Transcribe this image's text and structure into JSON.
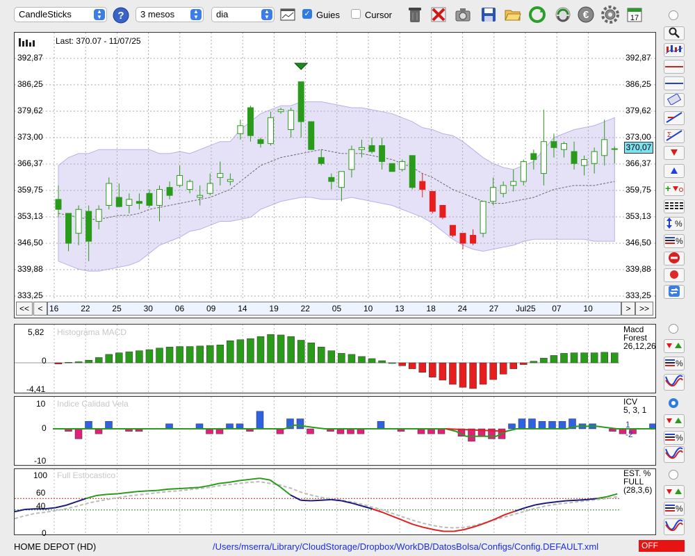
{
  "toolbar": {
    "chart_type": "CandleSticks",
    "period": "3 mesos",
    "interval": "dia",
    "guides_label": "Guies",
    "guides_checked": true,
    "cursor_label": "Cursor",
    "cursor_checked": false,
    "calendar_day": "17",
    "icons": [
      "help-icon",
      "chart-window-icon",
      "trash-icon",
      "delete-icon",
      "camera-icon",
      "save-icon",
      "open-folder-icon",
      "refresh-icon",
      "sync-icon",
      "currency-euro-icon",
      "settings-gear-icon",
      "calendar-icon"
    ]
  },
  "chart": {
    "last_label": "Last: 370.07 - 11/07/25",
    "current_price_tag": "370,07",
    "y_ticks": [
      "392,87",
      "386,25",
      "379,62",
      "373,00",
      "366,37",
      "359,75",
      "353,13",
      "346,50",
      "339,88",
      "333,25"
    ],
    "y_tick_values": [
      392.87,
      386.25,
      379.62,
      373.0,
      366.37,
      359.75,
      353.13,
      346.5,
      339.88,
      333.25
    ],
    "x_labels": [
      "16",
      "22",
      "25",
      "30",
      "06",
      "09",
      "14",
      "19",
      "22",
      "05",
      "10",
      "13",
      "18",
      "24",
      "27",
      "Jul25",
      "07",
      "10"
    ],
    "nav": {
      "first": "<<",
      "prev": "<",
      "next": ">",
      "last": ">>"
    },
    "colors": {
      "up": "#2a9a1a",
      "down": "#e81e1e",
      "band": "#dcd8f4",
      "price_tag": "#7fe0f0"
    }
  },
  "chart_data": [
    {
      "type": "candlestick",
      "title": "Last: 370.07 - 11/07/25",
      "ylim": [
        333.25,
        392.87
      ],
      "candles": [
        {
          "o": 357.5,
          "h": 361,
          "l": 353,
          "c": 355
        },
        {
          "o": 354,
          "h": 354,
          "l": 344.5,
          "c": 346.5
        },
        {
          "o": 349,
          "h": 356,
          "l": 346,
          "c": 355
        },
        {
          "o": 354.5,
          "h": 356,
          "l": 342,
          "c": 347
        },
        {
          "o": 352,
          "h": 356,
          "l": 350,
          "c": 355
        },
        {
          "o": 356,
          "h": 363,
          "l": 355,
          "c": 361.5
        },
        {
          "o": 358,
          "h": 361.5,
          "l": 355.5,
          "c": 355.7
        },
        {
          "o": 356,
          "h": 359,
          "l": 354,
          "c": 357.5
        },
        {
          "o": 357,
          "h": 359,
          "l": 355,
          "c": 356.5
        },
        {
          "o": 359,
          "h": 360,
          "l": 355.5,
          "c": 356
        },
        {
          "o": 356,
          "h": 361,
          "l": 352,
          "c": 360
        },
        {
          "o": 360.5,
          "h": 362,
          "l": 357.5,
          "c": 358.5
        },
        {
          "o": 361,
          "h": 366,
          "l": 360.5,
          "c": 363.5
        },
        {
          "o": 360,
          "h": 362.5,
          "l": 359,
          "c": 362
        },
        {
          "o": 358,
          "h": 361,
          "l": 356,
          "c": 358.5
        },
        {
          "o": 359,
          "h": 364,
          "l": 358.5,
          "c": 361.5
        },
        {
          "o": 363,
          "h": 367,
          "l": 361,
          "c": 364
        },
        {
          "o": 362,
          "h": 364,
          "l": 361,
          "c": 362.5
        },
        {
          "o": 374,
          "h": 377.5,
          "l": 372.5,
          "c": 376
        },
        {
          "o": 380.5,
          "h": 381,
          "l": 372,
          "c": 373.5
        },
        {
          "o": 372.5,
          "h": 373,
          "l": 370.5,
          "c": 371.5
        },
        {
          "o": 371.5,
          "h": 379.5,
          "l": 371,
          "c": 378
        },
        {
          "o": 379.5,
          "h": 380.5,
          "l": 379,
          "c": 380
        },
        {
          "o": 375,
          "h": 380.5,
          "l": 373,
          "c": 379.8
        },
        {
          "o": 387,
          "h": 387,
          "l": 373,
          "c": 377
        },
        {
          "o": 377,
          "h": 377,
          "l": 370,
          "c": 370
        },
        {
          "o": 368,
          "h": 370,
          "l": 366,
          "c": 366.5
        },
        {
          "o": 363,
          "h": 364,
          "l": 360,
          "c": 362
        },
        {
          "o": 360.5,
          "h": 364.5,
          "l": 357,
          "c": 364.5
        },
        {
          "o": 365,
          "h": 371,
          "l": 363,
          "c": 370
        },
        {
          "o": 370,
          "h": 372.5,
          "l": 368,
          "c": 370.5
        },
        {
          "o": 371,
          "h": 373,
          "l": 369,
          "c": 369.5
        },
        {
          "o": 371,
          "h": 373,
          "l": 365,
          "c": 367
        },
        {
          "o": 366.5,
          "h": 366.5,
          "l": 364.5,
          "c": 364.5
        },
        {
          "o": 365,
          "h": 367.5,
          "l": 364.5,
          "c": 367
        },
        {
          "o": 368.5,
          "h": 368.5,
          "l": 360,
          "c": 360.5
        },
        {
          "o": 360,
          "h": 364,
          "l": 358,
          "c": 362
        },
        {
          "o": 359.5,
          "h": 359.5,
          "l": 354,
          "c": 354.5
        },
        {
          "o": 356,
          "h": 356,
          "l": 352.5,
          "c": 353
        },
        {
          "o": 351,
          "h": 351,
          "l": 348,
          "c": 348.5
        },
        {
          "o": 349,
          "h": 349,
          "l": 345,
          "c": 346.5
        },
        {
          "o": 346.5,
          "h": 350,
          "l": 346,
          "c": 348.5
        },
        {
          "o": 349,
          "h": 357,
          "l": 348,
          "c": 357
        },
        {
          "o": 357,
          "h": 363,
          "l": 356,
          "c": 360.5
        },
        {
          "o": 359,
          "h": 362,
          "l": 358,
          "c": 361
        },
        {
          "o": 361,
          "h": 365,
          "l": 359.5,
          "c": 362
        },
        {
          "o": 362,
          "h": 367.5,
          "l": 361,
          "c": 367
        },
        {
          "o": 369,
          "h": 370,
          "l": 365,
          "c": 367.5
        },
        {
          "o": 364,
          "h": 380,
          "l": 361,
          "c": 372
        },
        {
          "o": 372,
          "h": 374,
          "l": 368,
          "c": 370.5
        },
        {
          "o": 370,
          "h": 372,
          "l": 368,
          "c": 371.5
        },
        {
          "o": 369.5,
          "h": 372,
          "l": 365,
          "c": 366.5
        },
        {
          "o": 366,
          "h": 368.5,
          "l": 363.5,
          "c": 367.5
        },
        {
          "o": 366.5,
          "h": 370.5,
          "l": 364,
          "c": 369.5
        },
        {
          "o": 368.5,
          "h": 377.5,
          "l": 366,
          "c": 372.5
        },
        {
          "o": 370.2,
          "h": 370.8,
          "l": 366.5,
          "c": 370.07
        }
      ],
      "bollinger_upper": [
        366,
        368,
        369,
        369,
        370,
        370,
        370,
        370,
        370,
        370,
        369,
        369,
        369.5,
        369,
        370,
        371,
        372,
        372,
        375,
        377,
        379,
        380,
        381,
        381,
        382,
        382,
        382,
        381.5,
        381,
        380.5,
        380.5,
        380,
        379.5,
        379,
        378,
        377,
        375.5,
        375,
        374,
        373.5,
        372,
        370,
        368,
        366.5,
        365.5,
        365,
        366,
        367,
        370,
        373,
        374,
        375,
        375.5,
        376,
        377,
        378
      ],
      "bollinger_lower": [
        342,
        341,
        340,
        339.5,
        339.5,
        340,
        340.5,
        341,
        342,
        344,
        346,
        347,
        348,
        349.5,
        350,
        351,
        352,
        352,
        352.5,
        353,
        355,
        356,
        357,
        357.5,
        358,
        358,
        357.5,
        357.5,
        357.5,
        358,
        357.5,
        357,
        356.5,
        356,
        355,
        354,
        353,
        351.5,
        349.5,
        347.5,
        346,
        345,
        344.5,
        345,
        345.5,
        346,
        347,
        347.5,
        347.5,
        347.5,
        347.5,
        347.5,
        347.5,
        347,
        347,
        347
      ],
      "sma_mid": [
        354,
        353.5,
        353,
        352.5,
        352.5,
        353,
        353.5,
        353.5,
        354,
        355,
        355.5,
        356,
        356.5,
        357,
        357.5,
        358,
        359,
        360,
        362,
        364,
        366,
        367,
        368,
        368.5,
        369,
        369.5,
        370,
        369.5,
        369,
        369,
        369,
        368.5,
        368,
        367.5,
        366.5,
        365.5,
        364,
        363,
        361.5,
        360,
        359,
        358,
        357,
        356.5,
        356.5,
        357,
        357.5,
        358,
        359,
        360,
        360.5,
        361,
        361,
        361,
        361.5,
        362
      ]
    },
    {
      "type": "bar",
      "title": "Histograma MACD",
      "series_label": "Macd Forest 26,12,26",
      "ylim": [
        -4.41,
        5.82
      ],
      "values": [
        -0.2,
        0.1,
        0.2,
        0.5,
        1.0,
        1.6,
        1.9,
        2.1,
        2.3,
        2.5,
        2.8,
        3.0,
        3.1,
        3.1,
        3.2,
        3.3,
        3.4,
        4.2,
        4.4,
        4.6,
        5.0,
        5.4,
        5.3,
        5.0,
        4.3,
        3.8,
        3.0,
        2.3,
        1.8,
        1.6,
        1.2,
        0.8,
        0.4,
        0,
        -0.5,
        -1.0,
        -1.6,
        -2.4,
        -2.9,
        -3.6,
        -4.1,
        -4.3,
        -3.6,
        -2.8,
        -1.9,
        -1.0,
        -0.3,
        0.3,
        0.9,
        1.4,
        1.8,
        1.9,
        1.9,
        1.9,
        2.0,
        1.9
      ]
    },
    {
      "type": "bar",
      "title": "Indice Calidad Vela",
      "series_label": "ICV 5, 3, 1",
      "legend": [
        "1",
        "-2"
      ],
      "ylim": [
        -10,
        10
      ],
      "values": [
        0,
        -1,
        -4,
        3,
        -2,
        3,
        0,
        -1,
        -1,
        0,
        0,
        2,
        0,
        0,
        2,
        -2,
        -2,
        2,
        2,
        -1,
        7,
        0,
        -2,
        4,
        4,
        -2,
        0,
        -1,
        -2,
        -2,
        -2,
        0,
        3,
        0,
        -1,
        0,
        -2,
        -2,
        -2,
        0,
        -3,
        -5,
        -3,
        -4,
        -4,
        2,
        4,
        4,
        3,
        3,
        3,
        4,
        2,
        2,
        0,
        -1,
        -2,
        -2,
        0,
        2,
        3,
        -2
      ],
      "signal_line": [
        0,
        0,
        0,
        0,
        0,
        0,
        0,
        0,
        0,
        0,
        0,
        0,
        0,
        0,
        0,
        0,
        0,
        0,
        0,
        0,
        0,
        0,
        0,
        0,
        1.5,
        1,
        0.5,
        0,
        0,
        0,
        0,
        0,
        0,
        0,
        0,
        0,
        0,
        0,
        0,
        0,
        -1,
        -3,
        -3,
        -3,
        -3,
        -1,
        0,
        0,
        0,
        0,
        0,
        0,
        1,
        1,
        1,
        0.5,
        0,
        0,
        0,
        0,
        0,
        0
      ]
    },
    {
      "type": "line",
      "title": "Full Estocastico",
      "series_label": "EST. % FULL (28,3,6)",
      "ylim": [
        0,
        100
      ],
      "levels": [
        60,
        40
      ],
      "k_line": [
        37,
        41,
        42,
        42,
        44,
        48,
        54,
        60,
        65,
        67,
        68,
        70,
        72,
        73,
        74,
        76,
        77,
        78,
        79,
        82,
        86,
        88,
        91,
        93,
        95,
        92,
        80,
        66,
        57,
        56,
        57,
        58,
        56,
        52,
        47,
        42,
        36,
        29,
        22,
        15,
        10,
        6,
        3,
        3,
        6,
        11,
        17,
        24,
        32,
        38,
        44,
        49,
        52,
        54,
        56,
        57,
        58,
        60,
        63,
        68
      ],
      "d_line": [
        25,
        30,
        34,
        36,
        39,
        42,
        46,
        51,
        55,
        58,
        61,
        64,
        66,
        68,
        70,
        72,
        73,
        75,
        77,
        79,
        82,
        84,
        86,
        88,
        89,
        86,
        83,
        78,
        71,
        66,
        62,
        59,
        57,
        54,
        50,
        45,
        40,
        34,
        28,
        22,
        17,
        13,
        10,
        9,
        10,
        13,
        18,
        23,
        28,
        33,
        38,
        43,
        47,
        50,
        52,
        54,
        56,
        58,
        60,
        63
      ]
    }
  ],
  "panels": {
    "macd": {
      "title": "Histograma MACD",
      "label_lines": [
        "Macd",
        "Forest",
        "26,12,26"
      ],
      "ticks": [
        "5,82",
        "0",
        "-4,41"
      ]
    },
    "icv": {
      "title": "Indice Calidad Vela",
      "label_lines": [
        "ICV",
        "5, 3, 1"
      ],
      "legend_1": "1",
      "legend_2": "-2",
      "ticks": [
        "10",
        "0",
        "-10"
      ]
    },
    "stoch": {
      "title": "Full Estocastico",
      "label_lines": [
        "EST. %",
        "FULL",
        "(28,3,6)"
      ],
      "ticks": [
        "100",
        "60",
        "40",
        "0"
      ]
    }
  },
  "status": {
    "ticker": "HOME DEPOT (HD)",
    "config_path": "/Users/mserra/Library/CloudStorage/Dropbox/WorkDB/DatosBolsa/Configs/Config.DEFAULT.xml",
    "off_badge": "OFF"
  },
  "sidebar_tools": [
    "zoom-icon",
    "candles-icon",
    "horizontal-line-red-icon",
    "horizontal-line-blue-icon",
    "channel-icon",
    "trend-line-icon",
    "fibonacci-icon",
    "arrow-down-icon",
    "arrow-up-icon",
    "add-remove-icon",
    "lines-icon",
    "percent-range-icon",
    "percent-lines-icon",
    "stop-icon",
    "record-icon",
    "swap-icon"
  ]
}
